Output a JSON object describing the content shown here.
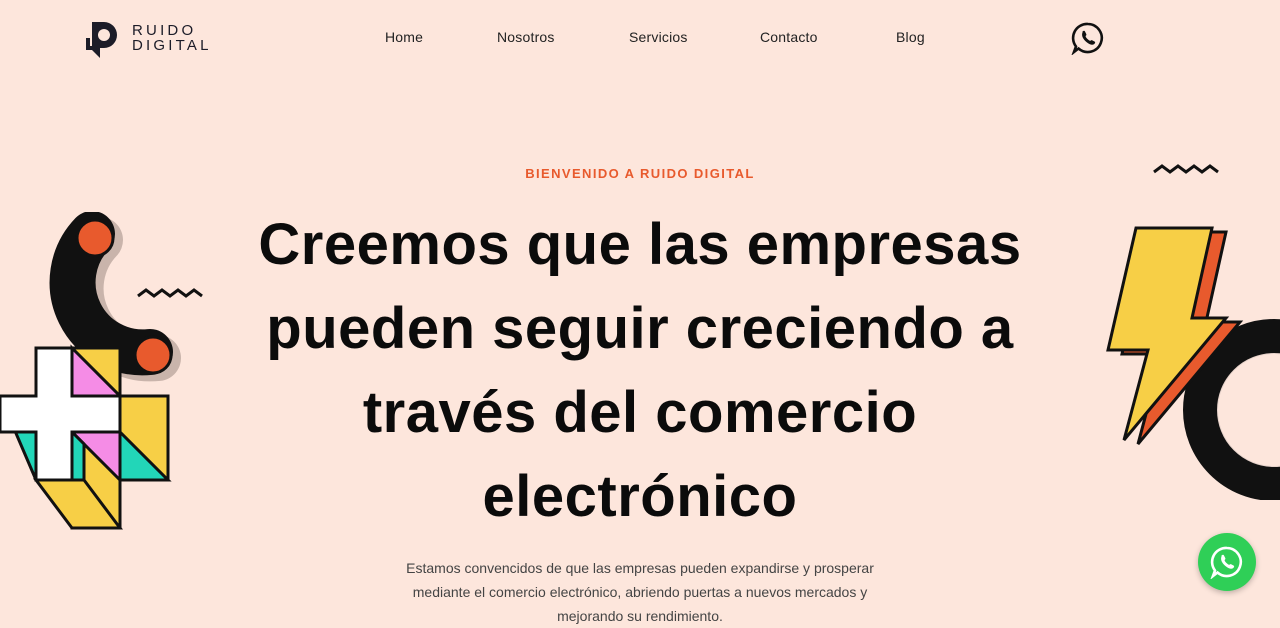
{
  "brand": {
    "line1": "RUIDO",
    "line2": "DIGITAL",
    "accent": "#e85a2d"
  },
  "nav": [
    {
      "label": "Home"
    },
    {
      "label": "Nosotros"
    },
    {
      "label": "Servicios"
    },
    {
      "label": "Contacto"
    },
    {
      "label": "Blog"
    }
  ],
  "header": {
    "whatsapp_icon": "whatsapp-icon"
  },
  "hero": {
    "kicker": "BIENVENIDO A RUIDO DIGITAL",
    "headline": "Creemos que las empresas pueden seguir creciendo a través del comercio electrónico",
    "lead": "Estamos convencidos de que las empresas pueden expandirse y prosperar mediante el comercio electrónico, abriendo puertas a nuevos mercados y mejorando su rendimiento."
  },
  "floating": {
    "whatsapp_icon": "whatsapp-icon",
    "color": "#2fcf57"
  },
  "colors": {
    "background": "#fde6dc",
    "orange": "#e85a2d",
    "yellow": "#f7cf46",
    "pink": "#f58ce6",
    "teal": "#22d6b8"
  }
}
